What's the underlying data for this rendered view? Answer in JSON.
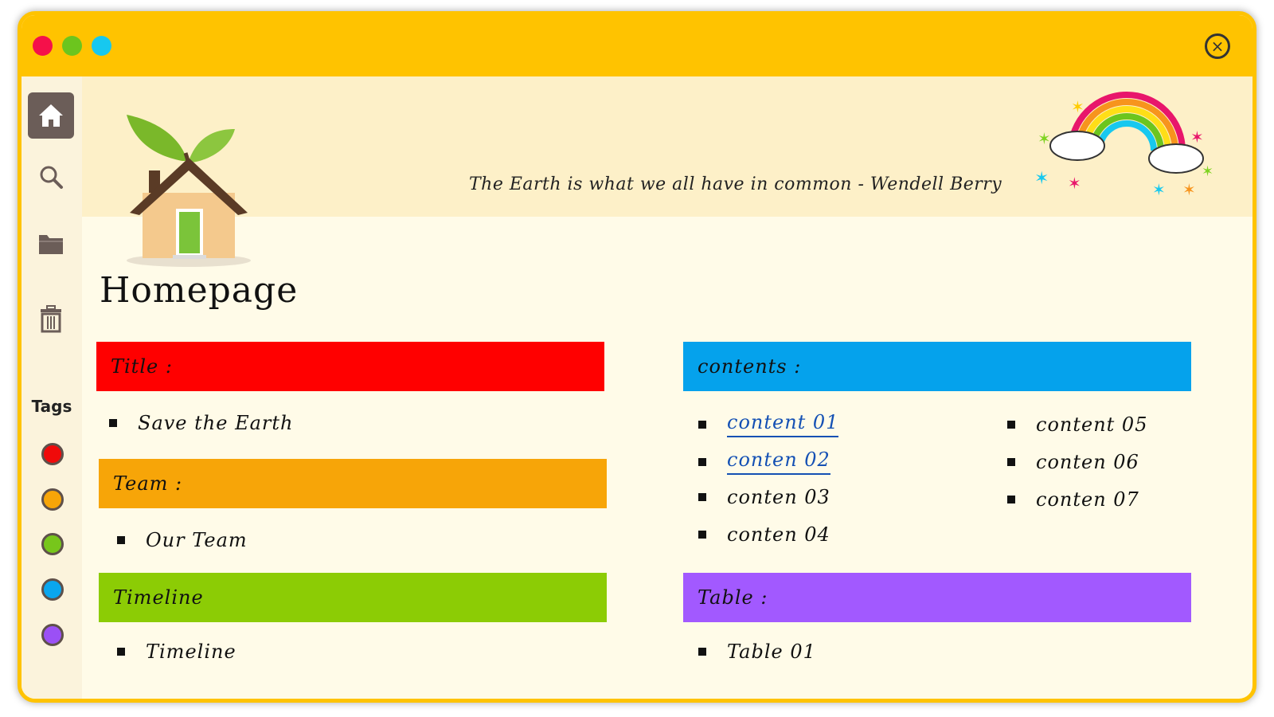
{
  "window": {
    "traffic_lights": [
      "red",
      "green",
      "cyan"
    ],
    "close_icon": "close-circle-icon"
  },
  "sidebar": {
    "items": [
      {
        "name": "home",
        "icon": "home-icon",
        "active": true
      },
      {
        "name": "search",
        "icon": "search-icon",
        "active": false
      },
      {
        "name": "folder",
        "icon": "folder-icon",
        "active": false
      },
      {
        "name": "trash",
        "icon": "trash-icon",
        "active": false
      }
    ],
    "tags_label": "Tags",
    "tag_colors": [
      "#f00a0a",
      "#f7a508",
      "#77c61b",
      "#0aa6ee",
      "#9b50f5"
    ]
  },
  "header": {
    "quote": "The Earth is what we all have in common - Wendell Berry"
  },
  "page": {
    "title": "Homepage"
  },
  "sections": {
    "title": {
      "label": "Title :",
      "color": "#ff0000",
      "items": [
        "Save the Earth"
      ]
    },
    "team": {
      "label": "Team :",
      "color": "#f7a508",
      "items": [
        "Our Team"
      ]
    },
    "timeline": {
      "label": "Timeline",
      "color": "#8ccc05",
      "items": [
        "Timeline"
      ]
    },
    "contents": {
      "label": "contents :",
      "color": "#05a2ec",
      "col1": [
        "content 01",
        "conten 02",
        "conten 03",
        "conten 04"
      ],
      "col2": [
        "content 05",
        "conten 06",
        "conten 07"
      ]
    },
    "table": {
      "label": "Table :",
      "color": "#a259ff",
      "items": [
        "Table 01"
      ]
    }
  }
}
